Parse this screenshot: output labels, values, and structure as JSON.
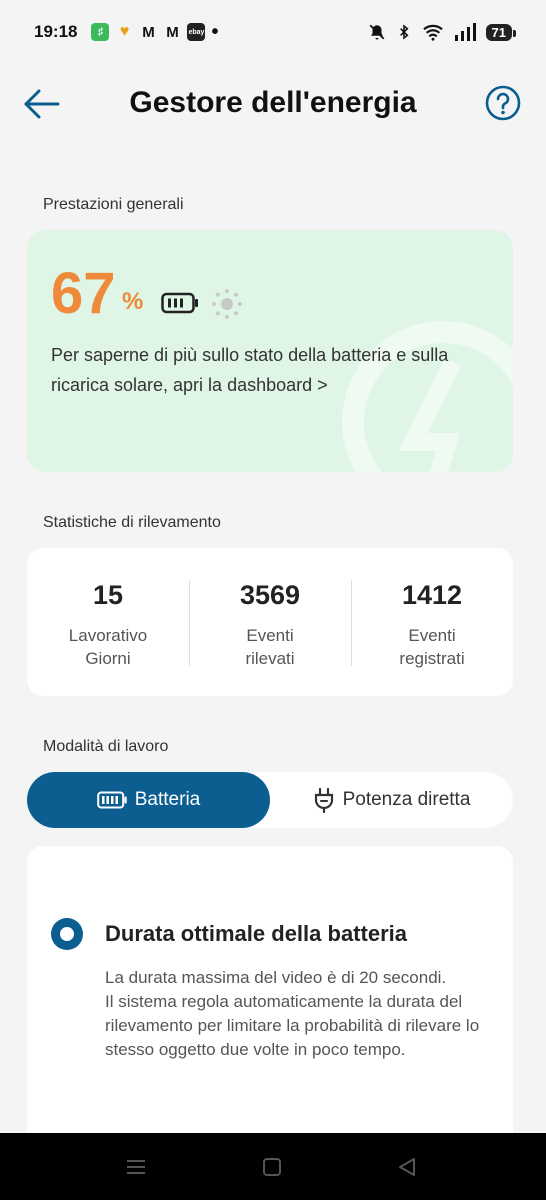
{
  "status_bar": {
    "time": "19:18",
    "battery_level": "71",
    "left_icons": [
      "app-green-icon",
      "app-heart-icon",
      "gmail-icon",
      "gmail-icon",
      "ebay-icon",
      "dot-icon"
    ],
    "right_icons": [
      "mute-icon",
      "bluetooth-icon",
      "wifi-icon",
      "signal-icon",
      "battery-icon"
    ]
  },
  "header": {
    "title": "Gestore dell'energia"
  },
  "performance": {
    "section_label": "Prestazioni generali",
    "value": "67",
    "unit": "%",
    "description": "Per saperne di più sullo stato della batteria e sulla ricarica solare, apri la dashboard >"
  },
  "stats": {
    "section_label": "Statistiche di rilevamento",
    "items": [
      {
        "value": "15",
        "label_line1": "Lavorativo",
        "label_line2": "Giorni"
      },
      {
        "value": "3569",
        "label_line1": "Eventi",
        "label_line2": "rilevati"
      },
      {
        "value": "1412",
        "label_line1": "Eventi",
        "label_line2": "registrati"
      }
    ]
  },
  "work_mode": {
    "section_label": "Modalità di lavoro",
    "options": [
      {
        "label": "Batteria",
        "selected": true
      },
      {
        "label": "Potenza diretta",
        "selected": false
      }
    ]
  },
  "mode_option": {
    "title": "Durata ottimale della batteria",
    "desc_line1": "La durata massima del video è di 20 secondi.",
    "desc_line2": "Il sistema regola automaticamente la durata del rilevamento per limitare la probabilità di rilevare lo stesso oggetto due volte in poco tempo."
  },
  "colors": {
    "accent": "#0b5e8f",
    "performance_value": "#ef8a3a",
    "performance_card_bg": "#dff5e5"
  }
}
